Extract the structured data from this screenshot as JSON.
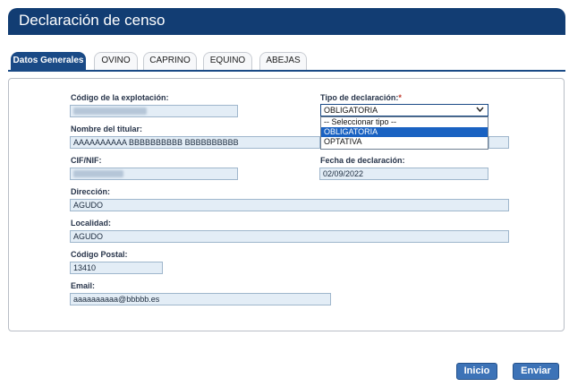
{
  "page_title": "Declaración de censo",
  "tabs": [
    {
      "label": "Datos Generales",
      "active": true
    },
    {
      "label": "OVINO"
    },
    {
      "label": "CAPRINO"
    },
    {
      "label": "EQUINO"
    },
    {
      "label": "ABEJAS"
    }
  ],
  "form": {
    "codigo_label": "Código de la explotación:",
    "tipo_label": "Tipo de declaración:",
    "tipo_required": "*",
    "tipo_selected": "OBLIGATORIA",
    "tipo_options": [
      "-- Seleccionar tipo --",
      "OBLIGATORIA",
      "OPTATIVA"
    ],
    "nombre_label": "Nombre del titular:",
    "nombre_value": "AAAAAAAAAA BBBBBBBBBB BBBBBBBBBB",
    "cif_label": "CIF/NIF:",
    "fecha_label": "Fecha de declaración:",
    "fecha_value": "02/09/2022",
    "direccion_label": "Dirección:",
    "direccion_value": "AGUDO",
    "localidad_label": "Localidad:",
    "localidad_value": "AGUDO",
    "cp_label": "Código Postal:",
    "cp_value": "13410",
    "email_label": "Email:",
    "email_value": "aaaaaaaaaa@bbbbb.es"
  },
  "buttons": {
    "inicio": "Inicio",
    "enviar": "Enviar"
  },
  "colors": {
    "header": "#123d73",
    "accent": "#1a4a86",
    "field_bg": "#e3edf6",
    "selected_option": "#1a62c2"
  }
}
